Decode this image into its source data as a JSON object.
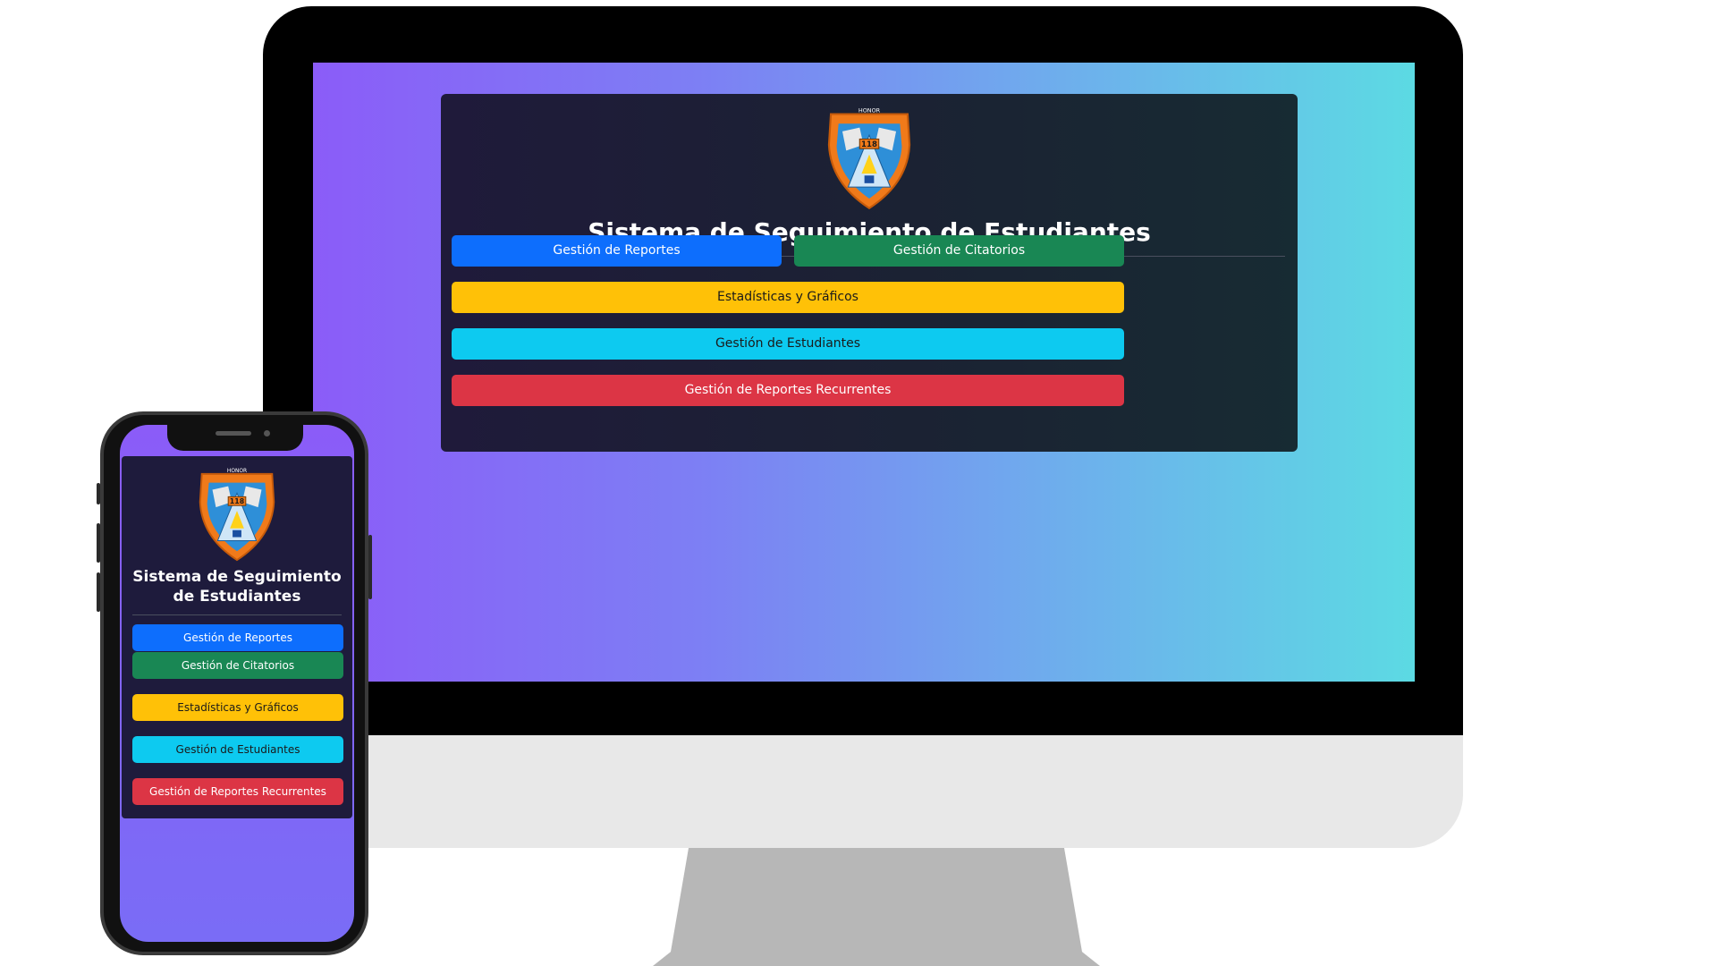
{
  "app": {
    "title": "Sistema de Seguimiento de Estudiantes"
  },
  "logo": {
    "motto": "HONOR",
    "school_number": "118",
    "left_text": "IDENTIDAD",
    "right_text": "CULTURA",
    "top_text": "ESC. SEC. GRAL."
  },
  "buttons": {
    "reportes": "Gestión de Reportes",
    "citatorios": "Gestión de Citatorios",
    "estadisticas": "Estadísticas y Gráficos",
    "estudiantes": "Gestión de Estudiantes",
    "recurrentes": "Gestión de Reportes Recurrentes"
  },
  "colors": {
    "primary": "#0d6efd",
    "success": "#198754",
    "warning": "#ffc107",
    "info": "#0dcaf0",
    "danger": "#dc3545",
    "gradient_start": "#8b5cf8",
    "gradient_end": "#5cdae3",
    "card_bg": "#1e1b3c"
  }
}
